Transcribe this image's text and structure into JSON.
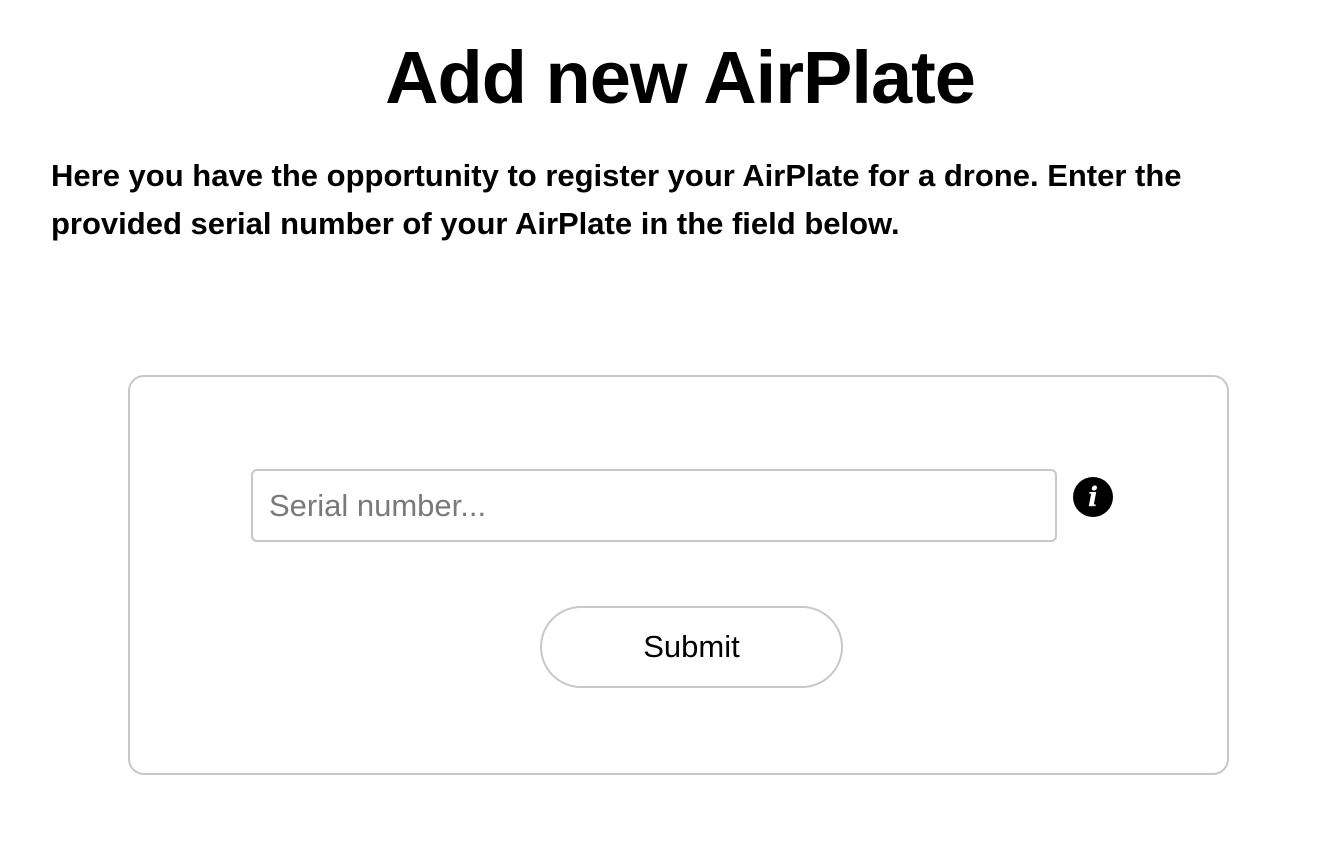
{
  "page": {
    "title": "Add new AirPlate",
    "description": "Here you have the opportunity to register your AirPlate for a drone. Enter the provided serial number of your AirPlate in the field below."
  },
  "form": {
    "serial_input": {
      "value": "",
      "placeholder": "Serial number..."
    },
    "info_icon": {
      "icon": "info-icon",
      "glyph": "i"
    },
    "submit_label": "Submit"
  },
  "colors": {
    "background": "#ffffff",
    "text": "#000000",
    "border": "#c8c8c8",
    "placeholder": "#7a7a7a",
    "icon_fill": "#000000"
  }
}
